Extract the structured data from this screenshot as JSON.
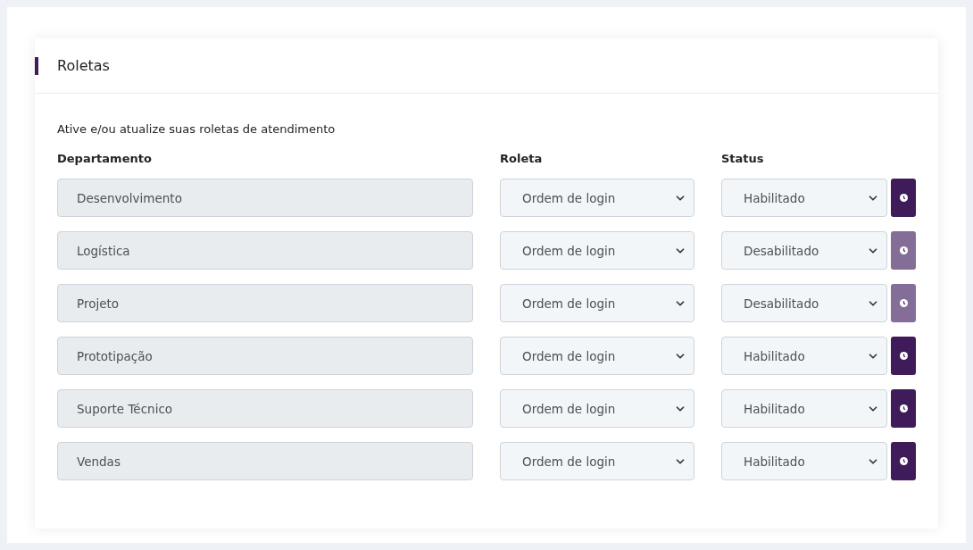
{
  "card": {
    "title": "Roletas",
    "description": "Ative e/ou atualize suas roletas de atendimento"
  },
  "columns": [
    "Departamento",
    "Roleta",
    "Status"
  ],
  "rows": [
    {
      "department": "Desenvolvimento",
      "roleta": "Ordem de login",
      "status": "Habilitado",
      "schedule_disabled": false
    },
    {
      "department": "Logística",
      "roleta": "Ordem de login",
      "status": "Desabilitado",
      "schedule_disabled": true
    },
    {
      "department": "Projeto",
      "roleta": "Ordem de login",
      "status": "Desabilitado",
      "schedule_disabled": true
    },
    {
      "department": "Prototipação",
      "roleta": "Ordem de login",
      "status": "Habilitado",
      "schedule_disabled": false
    },
    {
      "department": "Suporte Técnico",
      "roleta": "Ordem de login",
      "status": "Habilitado",
      "schedule_disabled": false
    },
    {
      "department": "Vendas",
      "roleta": "Ordem de login",
      "status": "Habilitado",
      "schedule_disabled": false
    }
  ]
}
